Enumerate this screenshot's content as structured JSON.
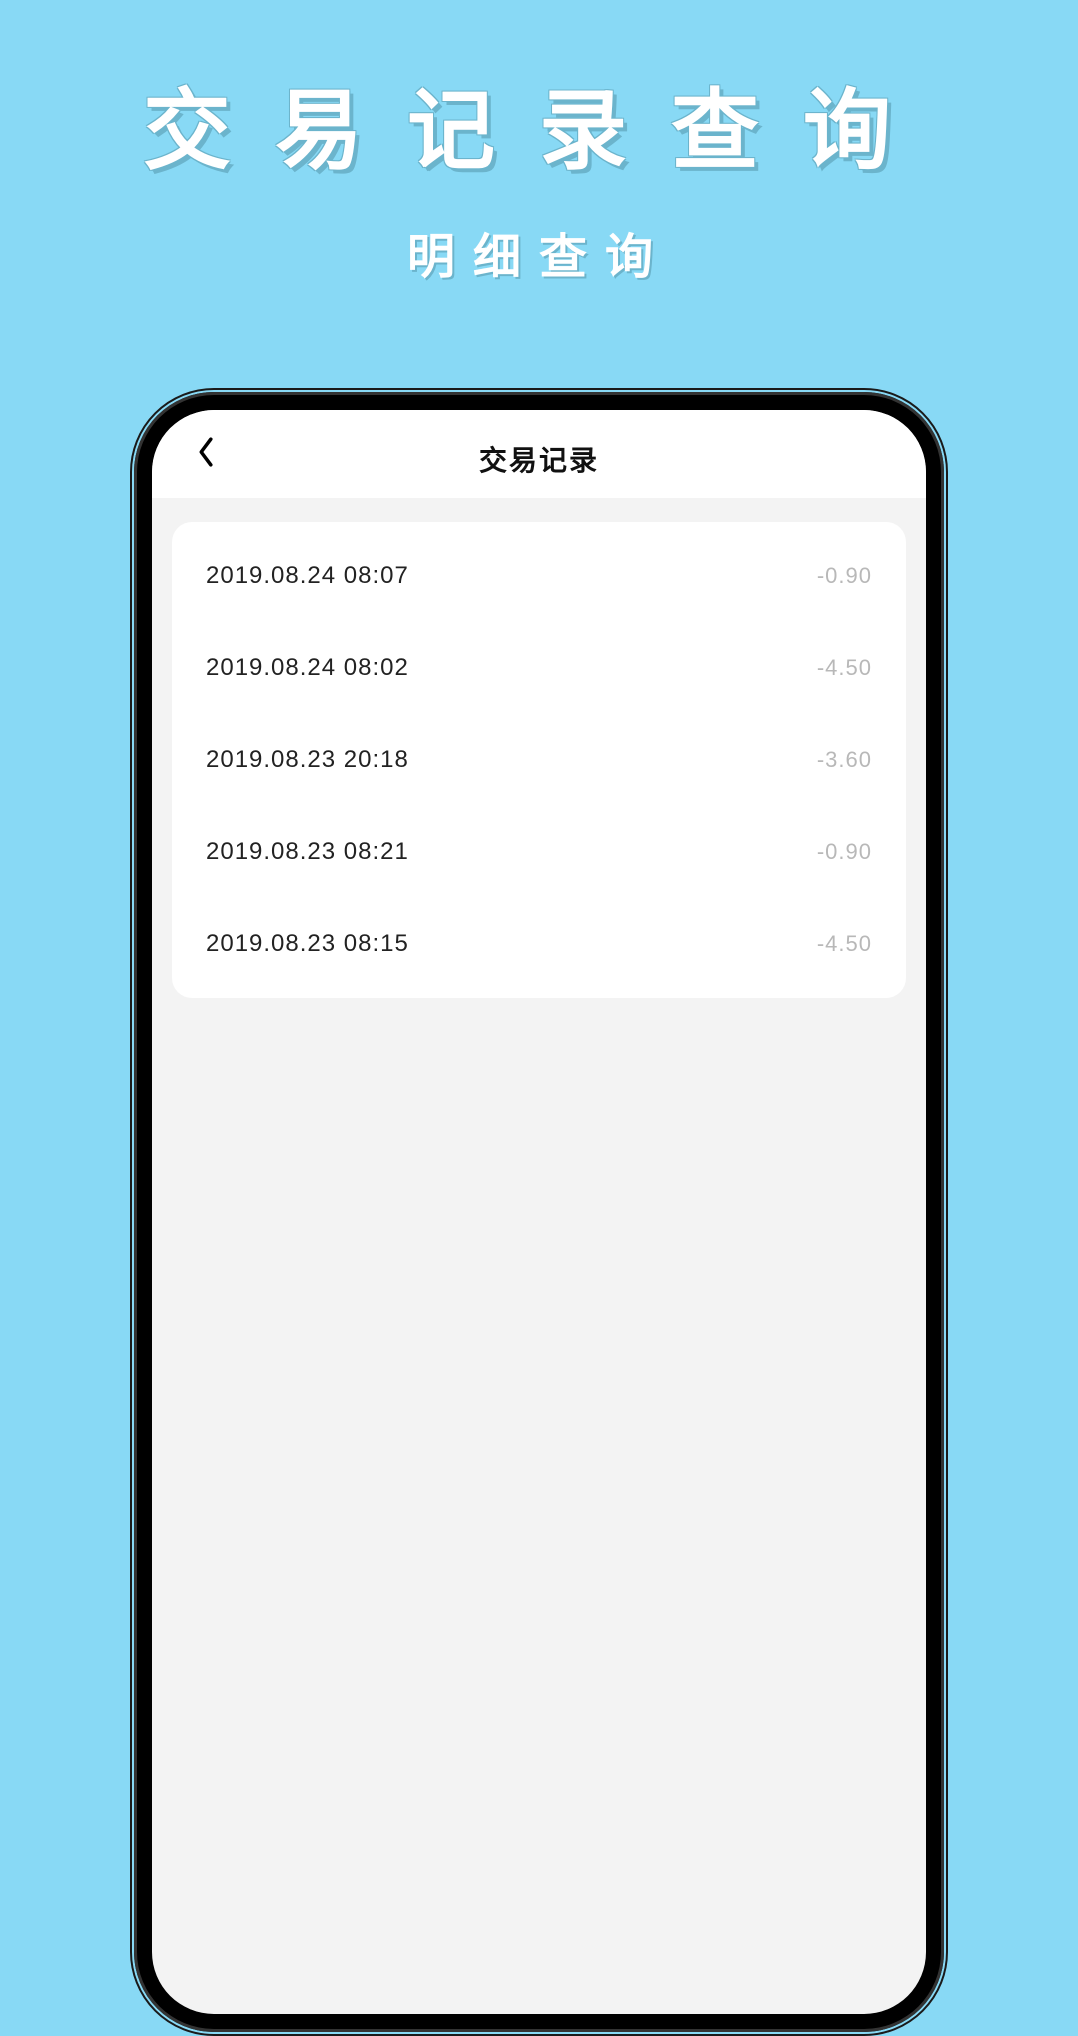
{
  "promo": {
    "title": "交易记录查询",
    "subtitle": "明细查询"
  },
  "app": {
    "header_title": "交易记录"
  },
  "transactions": [
    {
      "datetime": "2019.08.24 08:07",
      "amount": "-0.90"
    },
    {
      "datetime": "2019.08.24 08:02",
      "amount": "-4.50"
    },
    {
      "datetime": "2019.08.23 20:18",
      "amount": "-3.60"
    },
    {
      "datetime": "2019.08.23 08:21",
      "amount": "-0.90"
    },
    {
      "datetime": "2019.08.23 08:15",
      "amount": "-4.50"
    }
  ]
}
